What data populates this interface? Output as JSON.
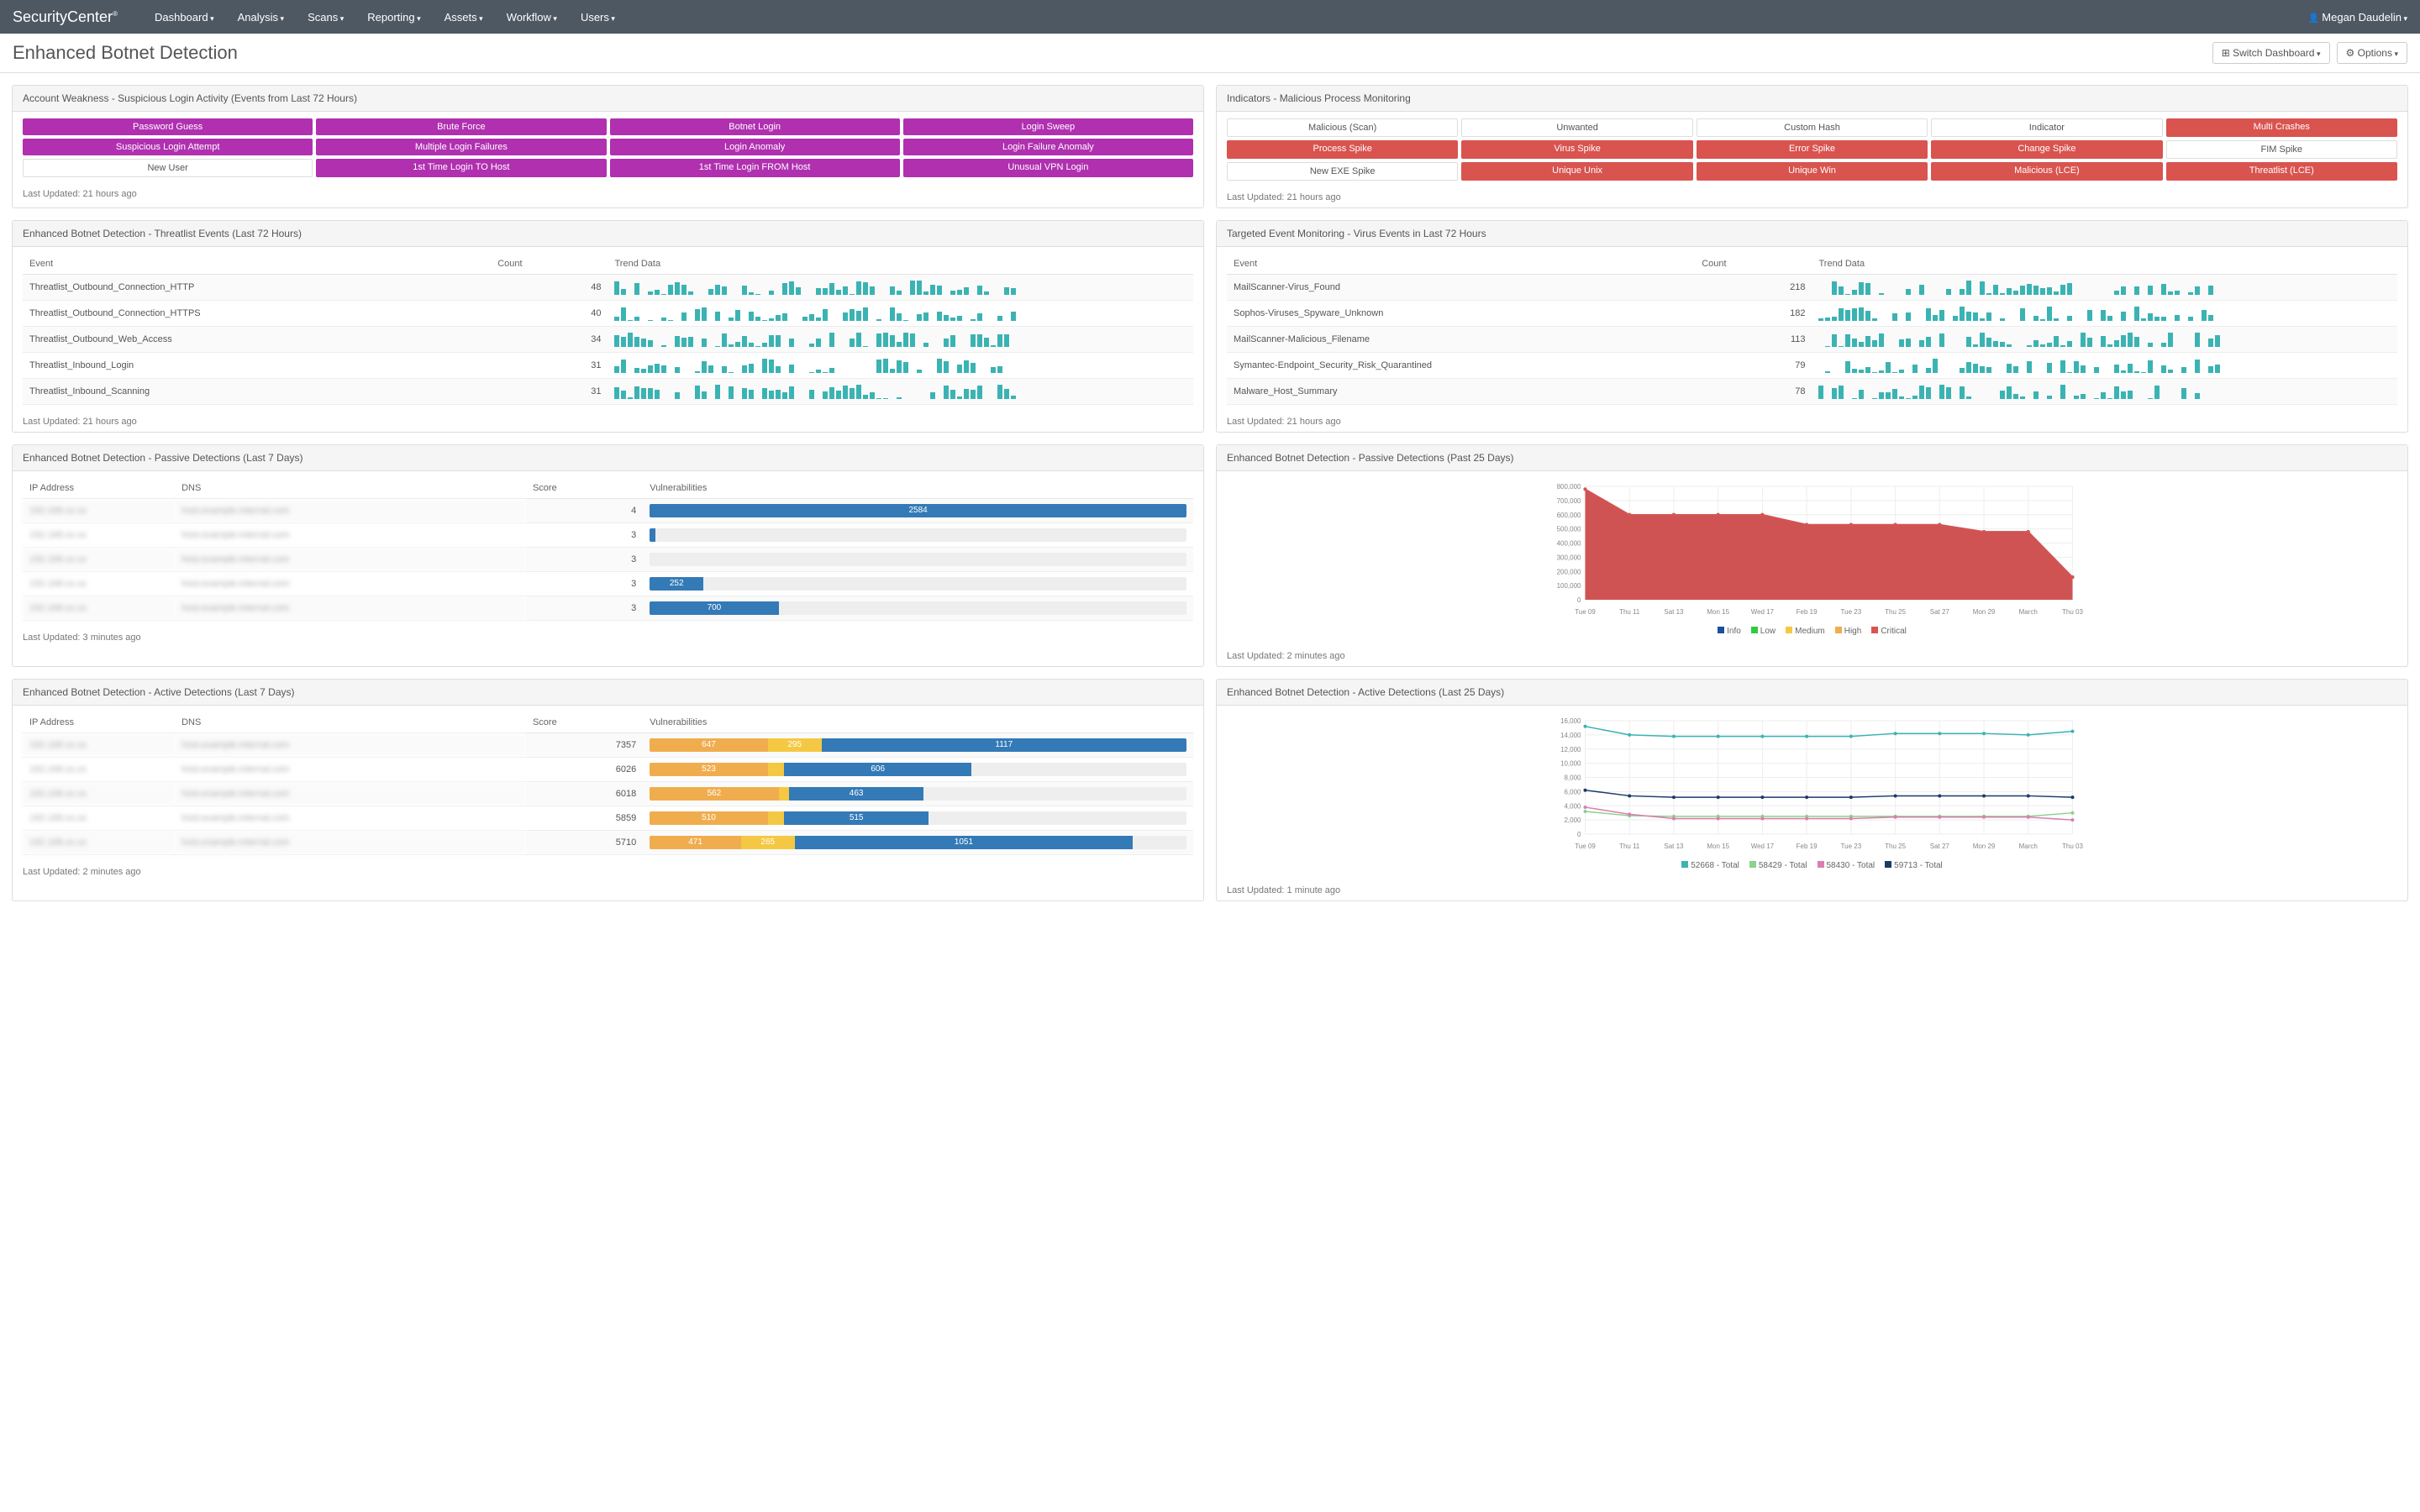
{
  "brand": "SecurityCenter",
  "nav": [
    "Dashboard",
    "Analysis",
    "Scans",
    "Reporting",
    "Assets",
    "Workflow",
    "Users"
  ],
  "user": "Megan Daudelin",
  "title": "Enhanced Botnet Detection",
  "btn_switch": "⊞ Switch Dashboard",
  "btn_options": "⚙ Options",
  "panels": {
    "acct": {
      "title": "Account Weakness - Suspicious Login Activity (Events from Last 72 Hours)",
      "cells": [
        {
          "label": "Password Guess",
          "c": "purple"
        },
        {
          "label": "Brute Force",
          "c": "purple"
        },
        {
          "label": "Botnet Login",
          "c": "purple"
        },
        {
          "label": "Login Sweep",
          "c": "purple"
        },
        {
          "label": "Suspicious Login Attempt",
          "c": "purple"
        },
        {
          "label": "Multiple Login Failures",
          "c": "purple"
        },
        {
          "label": "Login Anomaly",
          "c": "purple"
        },
        {
          "label": "Login Failure Anomaly",
          "c": "purple"
        },
        {
          "label": "New User",
          "c": "white"
        },
        {
          "label": "1st Time Login TO Host",
          "c": "purple"
        },
        {
          "label": "1st Time Login FROM Host",
          "c": "purple"
        },
        {
          "label": "Unusual VPN Login",
          "c": "purple"
        }
      ],
      "updated": "Last Updated: 21 hours ago"
    },
    "ind": {
      "title": "Indicators - Malicious Process Monitoring",
      "cells": [
        {
          "label": "Malicious (Scan)",
          "c": "white"
        },
        {
          "label": "Unwanted",
          "c": "white"
        },
        {
          "label": "Custom Hash",
          "c": "white"
        },
        {
          "label": "Indicator",
          "c": "white"
        },
        {
          "label": "Multi Crashes",
          "c": "red"
        },
        {
          "label": "Process Spike",
          "c": "red"
        },
        {
          "label": "Virus Spike",
          "c": "red"
        },
        {
          "label": "Error Spike",
          "c": "red"
        },
        {
          "label": "Change Spike",
          "c": "red"
        },
        {
          "label": "FIM Spike",
          "c": "white"
        },
        {
          "label": "New EXE Spike",
          "c": "white"
        },
        {
          "label": "Unique Unix",
          "c": "red"
        },
        {
          "label": "Unique Win",
          "c": "red"
        },
        {
          "label": "Malicious (LCE)",
          "c": "red"
        },
        {
          "label": "Threatlist (LCE)",
          "c": "red"
        }
      ],
      "updated": "Last Updated: 21 hours ago"
    },
    "threat": {
      "title": "Enhanced Botnet Detection - Threatlist Events (Last 72 Hours)",
      "cols": [
        "Event",
        "Count",
        "Trend Data"
      ],
      "rows": [
        {
          "e": "Threatlist_Outbound_Connection_HTTP",
          "c": 48
        },
        {
          "e": "Threatlist_Outbound_Connection_HTTPS",
          "c": 40
        },
        {
          "e": "Threatlist_Outbound_Web_Access",
          "c": 34
        },
        {
          "e": "Threatlist_Inbound_Login",
          "c": 31
        },
        {
          "e": "Threatlist_Inbound_Scanning",
          "c": 31
        }
      ],
      "updated": "Last Updated: 21 hours ago"
    },
    "virus": {
      "title": "Targeted Event Monitoring - Virus Events in Last 72 Hours",
      "cols": [
        "Event",
        "Count",
        "Trend Data"
      ],
      "rows": [
        {
          "e": "MailScanner-Virus_Found",
          "c": 218
        },
        {
          "e": "Sophos-Viruses_Spyware_Unknown",
          "c": 182
        },
        {
          "e": "MailScanner-Malicious_Filename",
          "c": 113
        },
        {
          "e": "Symantec-Endpoint_Security_Risk_Quarantined",
          "c": 79
        },
        {
          "e": "Malware_Host_Summary",
          "c": 78
        }
      ],
      "updated": "Last Updated: 21 hours ago"
    },
    "pass7": {
      "title": "Enhanced Botnet Detection - Passive Detections (Last 7 Days)",
      "cols": [
        "IP Address",
        "DNS",
        "Score",
        "Vulnerabilities"
      ],
      "rows": [
        {
          "score": 4,
          "segs": [
            {
              "c": "seg-blue",
              "w": 100,
              "t": "2584"
            }
          ]
        },
        {
          "score": 3,
          "segs": [
            {
              "c": "seg-blue",
              "w": 1,
              "t": ""
            }
          ]
        },
        {
          "score": 3,
          "segs": []
        },
        {
          "score": 3,
          "segs": [
            {
              "c": "seg-blue",
              "w": 10,
              "t": "252"
            }
          ]
        },
        {
          "score": 3,
          "segs": [
            {
              "c": "seg-blue",
              "w": 24,
              "t": "700"
            }
          ]
        }
      ],
      "updated": "Last Updated: 3 minutes ago"
    },
    "pass25": {
      "title": "Enhanced Botnet Detection - Passive Detections (Past 25 Days)",
      "legend": [
        {
          "l": "Info",
          "c": "#1b4f9c"
        },
        {
          "l": "Low",
          "c": "#2ecc40"
        },
        {
          "l": "Medium",
          "c": "#f4c842"
        },
        {
          "l": "High",
          "c": "#f0ad4e"
        },
        {
          "l": "Critical",
          "c": "#d9534f"
        }
      ],
      "updated": "Last Updated: 2 minutes ago"
    },
    "act7": {
      "title": "Enhanced Botnet Detection - Active Detections (Last 7 Days)",
      "cols": [
        "IP Address",
        "DNS",
        "Score",
        "Vulnerabilities"
      ],
      "rows": [
        {
          "score": 7357,
          "segs": [
            {
              "c": "seg-orange",
              "w": 22,
              "t": "647"
            },
            {
              "c": "seg-yellow",
              "w": 10,
              "t": "295"
            },
            {
              "c": "seg-blue",
              "w": 68,
              "t": "1117"
            }
          ]
        },
        {
          "score": 6026,
          "segs": [
            {
              "c": "seg-orange",
              "w": 22,
              "t": "523"
            },
            {
              "c": "seg-yellow",
              "w": 3,
              "t": ""
            },
            {
              "c": "seg-blue",
              "w": 35,
              "t": "606"
            }
          ]
        },
        {
          "score": 6018,
          "segs": [
            {
              "c": "seg-orange",
              "w": 24,
              "t": "562"
            },
            {
              "c": "seg-yellow",
              "w": 2,
              "t": ""
            },
            {
              "c": "seg-blue",
              "w": 25,
              "t": "463"
            }
          ]
        },
        {
          "score": 5859,
          "segs": [
            {
              "c": "seg-orange",
              "w": 22,
              "t": "510"
            },
            {
              "c": "seg-yellow",
              "w": 3,
              "t": ""
            },
            {
              "c": "seg-blue",
              "w": 27,
              "t": "515"
            }
          ]
        },
        {
          "score": 5710,
          "segs": [
            {
              "c": "seg-orange",
              "w": 17,
              "t": "471"
            },
            {
              "c": "seg-yellow",
              "w": 10,
              "t": "265"
            },
            {
              "c": "seg-blue",
              "w": 63,
              "t": "1051"
            }
          ]
        }
      ],
      "updated": "Last Updated: 2 minutes ago"
    },
    "act25": {
      "title": "Enhanced Botnet Detection - Active Detections (Last 25 Days)",
      "legend": [
        {
          "l": "52668 - Total",
          "c": "#3bb3b3"
        },
        {
          "l": "58429 - Total",
          "c": "#8ed08e"
        },
        {
          "l": "58430 - Total",
          "c": "#d97fb0"
        },
        {
          "l": "59713 - Total",
          "c": "#1b3a6b"
        }
      ],
      "updated": "Last Updated: 1 minute ago"
    }
  },
  "chart_data": [
    {
      "id": "pass25",
      "type": "area",
      "x": [
        "Tue 09",
        "Thu 11",
        "Sat 13",
        "Mon 15",
        "Wed 17",
        "Feb 19",
        "Tue 23",
        "Thu 25",
        "Sat 27",
        "Mon 29",
        "March",
        "Thu 03"
      ],
      "ylim": [
        0,
        800000
      ],
      "yticks": [
        0,
        100000,
        200000,
        300000,
        400000,
        500000,
        600000,
        700000,
        800000
      ],
      "series": [
        {
          "name": "Info",
          "color": "#1b4f9c",
          "values": [
            780000,
            600000,
            600000,
            600000,
            600000,
            530000,
            530000,
            530000,
            530000,
            480000,
            480000,
            160000
          ]
        },
        {
          "name": "Critical",
          "color": "#d9534f",
          "values": [
            780000,
            600000,
            600000,
            600000,
            600000,
            530000,
            530000,
            530000,
            530000,
            480000,
            480000,
            160000
          ]
        }
      ]
    },
    {
      "id": "act25",
      "type": "line",
      "x": [
        "Tue 09",
        "Thu 11",
        "Sat 13",
        "Mon 15",
        "Wed 17",
        "Feb 19",
        "Tue 23",
        "Thu 25",
        "Sat 27",
        "Mon 29",
        "March",
        "Thu 03"
      ],
      "ylim": [
        0,
        16000
      ],
      "yticks": [
        0,
        2000,
        4000,
        6000,
        8000,
        10000,
        12000,
        14000,
        16000
      ],
      "series": [
        {
          "name": "52668 - Total",
          "color": "#3bb3b3",
          "values": [
            15200,
            14000,
            13800,
            13800,
            13800,
            13800,
            13800,
            14200,
            14200,
            14200,
            14000,
            14500
          ]
        },
        {
          "name": "58429 - Total",
          "color": "#8ed08e",
          "values": [
            3200,
            2600,
            2500,
            2500,
            2500,
            2500,
            2500,
            2500,
            2500,
            2500,
            2500,
            3000
          ]
        },
        {
          "name": "58430 - Total",
          "color": "#d97fb0",
          "values": [
            3800,
            2800,
            2200,
            2200,
            2200,
            2200,
            2200,
            2400,
            2400,
            2400,
            2400,
            2000
          ]
        },
        {
          "name": "59713 - Total",
          "color": "#1b3a6b",
          "values": [
            6200,
            5400,
            5200,
            5200,
            5200,
            5200,
            5200,
            5400,
            5400,
            5400,
            5400,
            5200
          ]
        }
      ]
    }
  ]
}
